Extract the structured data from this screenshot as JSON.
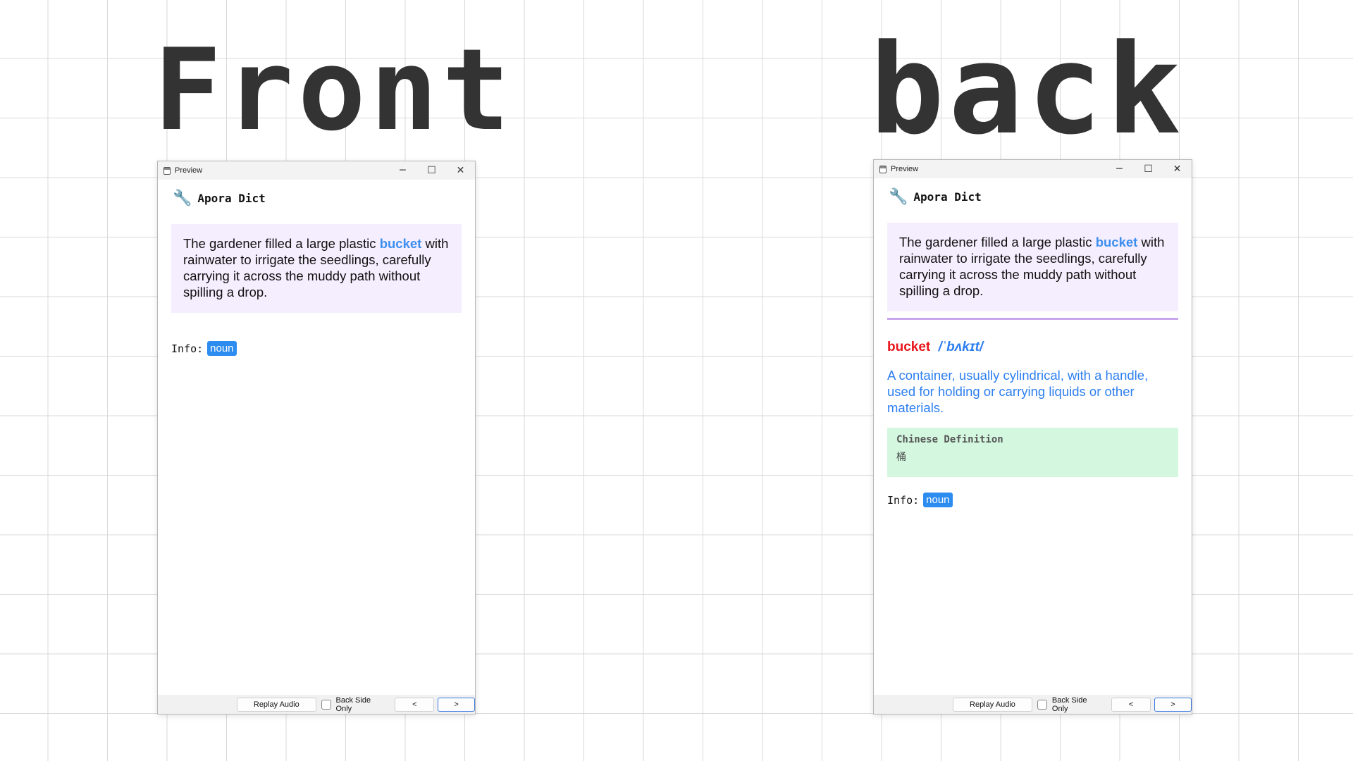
{
  "titles": {
    "front": "Front",
    "back": "back"
  },
  "window": {
    "title": "Preview",
    "minimize": "─",
    "maximize": "☐",
    "close": "✕"
  },
  "brand": {
    "icon": "wrench-icon",
    "glyph": "🔧",
    "name": "Apora Dict"
  },
  "card": {
    "sentence_before": "The gardener filled a large plastic ",
    "highlight": "bucket",
    "sentence_after": " with rainwater to irrigate the seedlings, carefully carrying it across the muddy path without spilling a drop.",
    "info_label": "Info:",
    "part_of_speech": "noun",
    "word": "bucket",
    "ipa": "/ˈbʌkɪt/",
    "definition": "A container, usually cylindrical, with a handle, used for holding or carrying liquids or other materials.",
    "chinese_label": "Chinese Definition",
    "chinese_value": "桶"
  },
  "footer": {
    "replay": "Replay Audio",
    "back_only": "Back Side Only",
    "prev": "<",
    "next": ">"
  },
  "colors": {
    "highlight": "#3b8ef0",
    "word": "#e8141b",
    "tag_bg": "#2d8cf0",
    "sentence_bg": "#f5eefe",
    "chinese_bg": "#d3f7df",
    "divider": "#c9a6ec"
  }
}
